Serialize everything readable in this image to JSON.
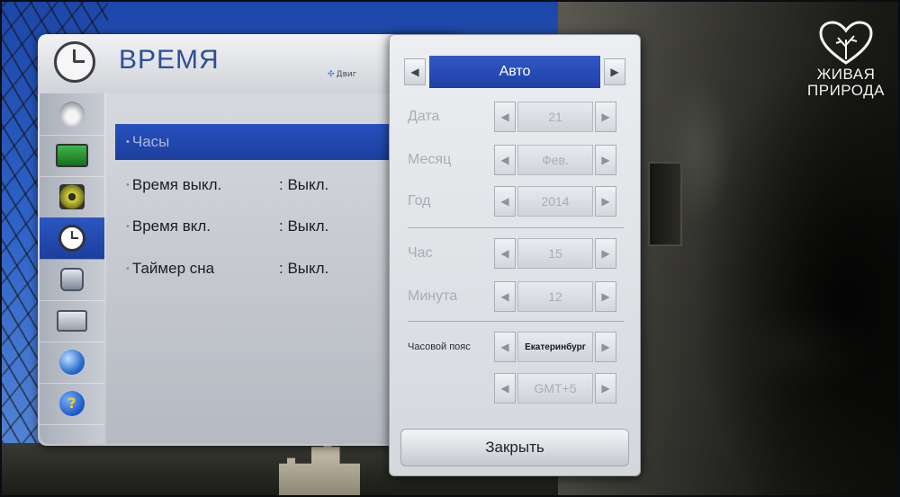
{
  "watermark": {
    "line1": "ЖИВАЯ",
    "line2": "ПРИРОДА"
  },
  "menu": {
    "title": "ВРЕМЯ",
    "hint": "Двиг",
    "sidebar": [
      {
        "icon": "satellite-icon"
      },
      {
        "icon": "tv-picture-icon"
      },
      {
        "icon": "speaker-icon"
      },
      {
        "icon": "clock-icon",
        "active": true
      },
      {
        "icon": "lock-icon"
      },
      {
        "icon": "briefcase-icon"
      },
      {
        "icon": "globe-network-icon"
      },
      {
        "icon": "help-icon",
        "label": "?"
      }
    ],
    "items": [
      {
        "label": "Часы",
        "value": ""
      },
      {
        "label": "Время выкл.",
        "value": ": Выкл."
      },
      {
        "label": "Время вкл.",
        "value": ": Выкл."
      },
      {
        "label": "Таймер сна",
        "value": ": Выкл."
      }
    ]
  },
  "popup": {
    "mode": "Авто",
    "fields": [
      {
        "label": "Дата",
        "value": "21"
      },
      {
        "label": "Месяц",
        "value": "Фев."
      },
      {
        "label": "Год",
        "value": "2014"
      },
      {
        "label": "Час",
        "value": "15"
      },
      {
        "label": "Минута",
        "value": "12"
      },
      {
        "label": "Часовой пояс",
        "value": "Екатеринбург"
      },
      {
        "label": "",
        "value": "GMT+5"
      }
    ],
    "close_label": "Закрыть",
    "arrow_left": "◀",
    "arrow_right": "▶"
  }
}
